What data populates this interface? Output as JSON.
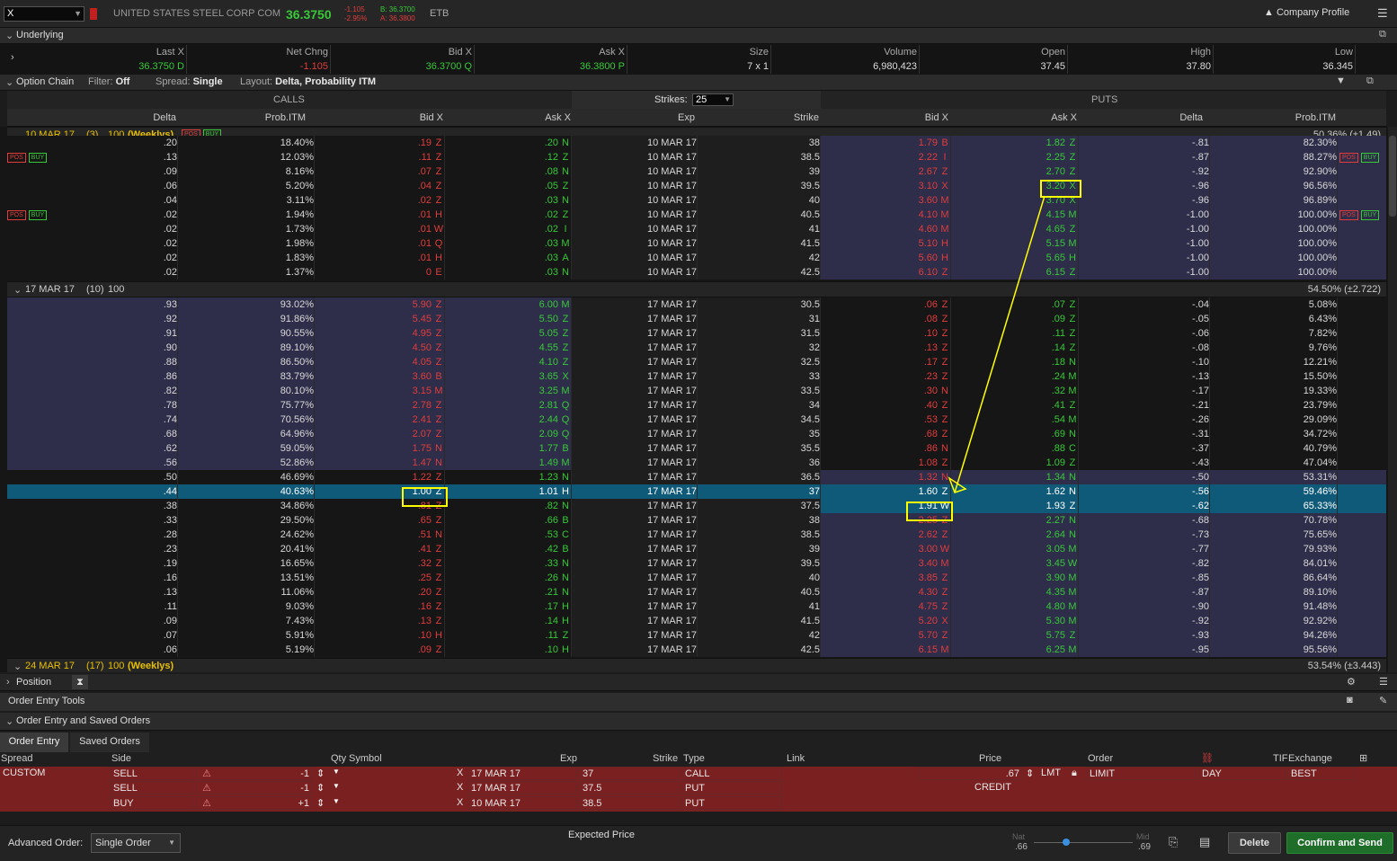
{
  "topbar": {
    "symbol": "X",
    "company": "UNITED STATES STEEL CORP COM",
    "last": "36.3750",
    "chg": "-1.105",
    "chg_pct": "-2.95%",
    "bid": "B: 36.3700",
    "ask": "A: 36.3800",
    "etb": "ETB",
    "profile": "Company Profile"
  },
  "underlying": {
    "title": "Underlying",
    "headers": [
      "Last X",
      "Net Chng",
      "Bid X",
      "Ask X",
      "Size",
      "Volume",
      "Open",
      "High",
      "Low"
    ],
    "values": [
      "36.3750 D",
      "-1.105",
      "36.3700 Q",
      "36.3800 P",
      "7 x 1",
      "6,980,423",
      "37.45",
      "37.80",
      "36.345"
    ]
  },
  "chain_toolbar": {
    "title": "Option Chain",
    "filter_label": "Filter:",
    "filter": "Off",
    "spread_label": "Spread:",
    "spread": "Single",
    "layout_label": "Layout:",
    "layout": "Delta, Probability ITM",
    "calls": "CALLS",
    "puts": "PUTS",
    "strikes_label": "Strikes:",
    "strikes": "25"
  },
  "col_headers": {
    "c_delta": "Delta",
    "c_prob": "Prob.ITM",
    "c_bid": "Bid X",
    "c_ask": "Ask X",
    "exp": "Exp",
    "strike": "Strike",
    "p_bid": "Bid X",
    "p_ask": "Ask X",
    "p_delta": "Delta",
    "p_prob": "Prob.ITM"
  },
  "badges": {
    "pos": "POS",
    "buy": "BUY"
  },
  "group1": {
    "date": "10 MAR 17",
    "count": "(3)",
    "mult": "100",
    "tag": "(Weeklys)",
    "iv": "50.36% (±1.49)"
  },
  "group1_rows": [
    {
      "cd": ".20",
      "cp": "18.40%",
      "cb": ".19",
      "cbx": "Z",
      "ca": ".20",
      "cax": "N",
      "exp": "10 MAR 17",
      "k": "38",
      "pb": "1.79",
      "pbx": "B",
      "pa": "1.82",
      "pax": "Z",
      "pd": "-.81",
      "pp": "82.30%"
    },
    {
      "cd": ".13",
      "cp": "12.03%",
      "cb": ".11",
      "cbx": "Z",
      "ca": ".12",
      "cax": "Z",
      "exp": "10 MAR 17",
      "k": "38.5",
      "pb": "2.22",
      "pbx": "I",
      "pa": "2.25",
      "pax": "Z",
      "pd": "-.87",
      "pp": "88.27%"
    },
    {
      "cd": ".09",
      "cp": "8.16%",
      "cb": ".07",
      "cbx": "Z",
      "ca": ".08",
      "cax": "N",
      "exp": "10 MAR 17",
      "k": "39",
      "pb": "2.67",
      "pbx": "Z",
      "pa": "2.70",
      "pax": "Z",
      "pd": "-.92",
      "pp": "92.90%"
    },
    {
      "cd": ".06",
      "cp": "5.20%",
      "cb": ".04",
      "cbx": "Z",
      "ca": ".05",
      "cax": "Z",
      "exp": "10 MAR 17",
      "k": "39.5",
      "pb": "3.10",
      "pbx": "X",
      "pa": "3.20",
      "pax": "X",
      "pd": "-.96",
      "pp": "96.56%"
    },
    {
      "cd": ".04",
      "cp": "3.11%",
      "cb": ".02",
      "cbx": "Z",
      "ca": ".03",
      "cax": "N",
      "exp": "10 MAR 17",
      "k": "40",
      "pb": "3.60",
      "pbx": "M",
      "pa": "3.70",
      "pax": "X",
      "pd": "-.96",
      "pp": "96.89%"
    },
    {
      "cd": ".02",
      "cp": "1.94%",
      "cb": ".01",
      "cbx": "H",
      "ca": ".02",
      "cax": "Z",
      "exp": "10 MAR 17",
      "k": "40.5",
      "pb": "4.10",
      "pbx": "M",
      "pa": "4.15",
      "pax": "M",
      "pd": "-1.00",
      "pp": "100.00%"
    },
    {
      "cd": ".02",
      "cp": "1.73%",
      "cb": ".01",
      "cbx": "W",
      "ca": ".02",
      "cax": "I",
      "exp": "10 MAR 17",
      "k": "41",
      "pb": "4.60",
      "pbx": "M",
      "pa": "4.65",
      "pax": "Z",
      "pd": "-1.00",
      "pp": "100.00%"
    },
    {
      "cd": ".02",
      "cp": "1.98%",
      "cb": ".01",
      "cbx": "Q",
      "ca": ".03",
      "cax": "M",
      "exp": "10 MAR 17",
      "k": "41.5",
      "pb": "5.10",
      "pbx": "H",
      "pa": "5.15",
      "pax": "M",
      "pd": "-1.00",
      "pp": "100.00%"
    },
    {
      "cd": ".02",
      "cp": "1.83%",
      "cb": ".01",
      "cbx": "H",
      "ca": ".03",
      "cax": "A",
      "exp": "10 MAR 17",
      "k": "42",
      "pb": "5.60",
      "pbx": "H",
      "pa": "5.65",
      "pax": "H",
      "pd": "-1.00",
      "pp": "100.00%"
    },
    {
      "cd": ".02",
      "cp": "1.37%",
      "cb": "0",
      "cbx": "E",
      "ca": ".03",
      "cax": "N",
      "exp": "10 MAR 17",
      "k": "42.5",
      "pb": "6.10",
      "pbx": "Z",
      "pa": "6.15",
      "pax": "Z",
      "pd": "-1.00",
      "pp": "100.00%"
    }
  ],
  "group2": {
    "date": "17 MAR 17",
    "count": "(10)",
    "mult": "100",
    "tag": "",
    "iv": "54.50% (±2.722)"
  },
  "group2_rows": [
    {
      "cd": ".93",
      "cp": "93.02%",
      "cb": "5.90",
      "cbx": "Z",
      "ca": "6.00",
      "cax": "M",
      "exp": "17 MAR 17",
      "k": "30.5",
      "pb": ".06",
      "pbx": "Z",
      "pa": ".07",
      "pax": "Z",
      "pd": "-.04",
      "pp": "5.08%"
    },
    {
      "cd": ".92",
      "cp": "91.86%",
      "cb": "5.45",
      "cbx": "Z",
      "ca": "5.50",
      "cax": "Z",
      "exp": "17 MAR 17",
      "k": "31",
      "pb": ".08",
      "pbx": "Z",
      "pa": ".09",
      "pax": "Z",
      "pd": "-.05",
      "pp": "6.43%"
    },
    {
      "cd": ".91",
      "cp": "90.55%",
      "cb": "4.95",
      "cbx": "Z",
      "ca": "5.05",
      "cax": "Z",
      "exp": "17 MAR 17",
      "k": "31.5",
      "pb": ".10",
      "pbx": "Z",
      "pa": ".11",
      "pax": "Z",
      "pd": "-.06",
      "pp": "7.82%"
    },
    {
      "cd": ".90",
      "cp": "89.10%",
      "cb": "4.50",
      "cbx": "Z",
      "ca": "4.55",
      "cax": "Z",
      "exp": "17 MAR 17",
      "k": "32",
      "pb": ".13",
      "pbx": "Z",
      "pa": ".14",
      "pax": "Z",
      "pd": "-.08",
      "pp": "9.76%"
    },
    {
      "cd": ".88",
      "cp": "86.50%",
      "cb": "4.05",
      "cbx": "Z",
      "ca": "4.10",
      "cax": "Z",
      "exp": "17 MAR 17",
      "k": "32.5",
      "pb": ".17",
      "pbx": "Z",
      "pa": ".18",
      "pax": "N",
      "pd": "-.10",
      "pp": "12.21%"
    },
    {
      "cd": ".86",
      "cp": "83.79%",
      "cb": "3.60",
      "cbx": "B",
      "ca": "3.65",
      "cax": "X",
      "exp": "17 MAR 17",
      "k": "33",
      "pb": ".23",
      "pbx": "Z",
      "pa": ".24",
      "pax": "M",
      "pd": "-.13",
      "pp": "15.50%"
    },
    {
      "cd": ".82",
      "cp": "80.10%",
      "cb": "3.15",
      "cbx": "M",
      "ca": "3.25",
      "cax": "M",
      "exp": "17 MAR 17",
      "k": "33.5",
      "pb": ".30",
      "pbx": "N",
      "pa": ".32",
      "pax": "M",
      "pd": "-.17",
      "pp": "19.33%"
    },
    {
      "cd": ".78",
      "cp": "75.77%",
      "cb": "2.78",
      "cbx": "Z",
      "ca": "2.81",
      "cax": "Q",
      "exp": "17 MAR 17",
      "k": "34",
      "pb": ".40",
      "pbx": "Z",
      "pa": ".41",
      "pax": "Z",
      "pd": "-.21",
      "pp": "23.79%"
    },
    {
      "cd": ".74",
      "cp": "70.56%",
      "cb": "2.41",
      "cbx": "Z",
      "ca": "2.44",
      "cax": "Q",
      "exp": "17 MAR 17",
      "k": "34.5",
      "pb": ".53",
      "pbx": "Z",
      "pa": ".54",
      "pax": "M",
      "pd": "-.26",
      "pp": "29.09%"
    },
    {
      "cd": ".68",
      "cp": "64.96%",
      "cb": "2.07",
      "cbx": "Z",
      "ca": "2.09",
      "cax": "Q",
      "exp": "17 MAR 17",
      "k": "35",
      "pb": ".68",
      "pbx": "Z",
      "pa": ".69",
      "pax": "N",
      "pd": "-.31",
      "pp": "34.72%"
    },
    {
      "cd": ".62",
      "cp": "59.05%",
      "cb": "1.75",
      "cbx": "N",
      "ca": "1.77",
      "cax": "B",
      "exp": "17 MAR 17",
      "k": "35.5",
      "pb": ".86",
      "pbx": "N",
      "pa": ".88",
      "pax": "C",
      "pd": "-.37",
      "pp": "40.79%"
    },
    {
      "cd": ".56",
      "cp": "52.86%",
      "cb": "1.47",
      "cbx": "N",
      "ca": "1.49",
      "cax": "M",
      "exp": "17 MAR 17",
      "k": "36",
      "pb": "1.08",
      "pbx": "Z",
      "pa": "1.09",
      "pax": "Z",
      "pd": "-.43",
      "pp": "47.04%"
    },
    {
      "cd": ".50",
      "cp": "46.69%",
      "cb": "1.22",
      "cbx": "Z",
      "ca": "1.23",
      "cax": "N",
      "exp": "17 MAR 17",
      "k": "36.5",
      "pb": "1.32",
      "pbx": "N",
      "pa": "1.34",
      "pax": "N",
      "pd": "-.50",
      "pp": "53.31%"
    },
    {
      "cd": ".44",
      "cp": "40.63%",
      "cb": "1.00",
      "cbx": "Z",
      "ca": "1.01",
      "cax": "H",
      "exp": "17 MAR 17",
      "k": "37",
      "pb": "1.60",
      "pbx": "Z",
      "pa": "1.62",
      "pax": "N",
      "pd": "-.56",
      "pp": "59.46%"
    },
    {
      "cd": ".38",
      "cp": "34.86%",
      "cb": ".81",
      "cbx": "Z",
      "ca": ".82",
      "cax": "N",
      "exp": "17 MAR 17",
      "k": "37.5",
      "pb": "1.91",
      "pbx": "W",
      "pa": "1.93",
      "pax": "Z",
      "pd": "-.62",
      "pp": "65.33%"
    },
    {
      "cd": ".33",
      "cp": "29.50%",
      "cb": ".65",
      "cbx": "Z",
      "ca": ".66",
      "cax": "B",
      "exp": "17 MAR 17",
      "k": "38",
      "pb": "2.25",
      "pbx": "Z",
      "pa": "2.27",
      "pax": "N",
      "pd": "-.68",
      "pp": "70.78%"
    },
    {
      "cd": ".28",
      "cp": "24.62%",
      "cb": ".51",
      "cbx": "N",
      "ca": ".53",
      "cax": "C",
      "exp": "17 MAR 17",
      "k": "38.5",
      "pb": "2.62",
      "pbx": "Z",
      "pa": "2.64",
      "pax": "N",
      "pd": "-.73",
      "pp": "75.65%"
    },
    {
      "cd": ".23",
      "cp": "20.41%",
      "cb": ".41",
      "cbx": "Z",
      "ca": ".42",
      "cax": "B",
      "exp": "17 MAR 17",
      "k": "39",
      "pb": "3.00",
      "pbx": "W",
      "pa": "3.05",
      "pax": "M",
      "pd": "-.77",
      "pp": "79.93%"
    },
    {
      "cd": ".19",
      "cp": "16.65%",
      "cb": ".32",
      "cbx": "Z",
      "ca": ".33",
      "cax": "N",
      "exp": "17 MAR 17",
      "k": "39.5",
      "pb": "3.40",
      "pbx": "M",
      "pa": "3.45",
      "pax": "W",
      "pd": "-.82",
      "pp": "84.01%"
    },
    {
      "cd": ".16",
      "cp": "13.51%",
      "cb": ".25",
      "cbx": "Z",
      "ca": ".26",
      "cax": "N",
      "exp": "17 MAR 17",
      "k": "40",
      "pb": "3.85",
      "pbx": "Z",
      "pa": "3.90",
      "pax": "M",
      "pd": "-.85",
      "pp": "86.64%"
    },
    {
      "cd": ".13",
      "cp": "11.06%",
      "cb": ".20",
      "cbx": "Z",
      "ca": ".21",
      "cax": "N",
      "exp": "17 MAR 17",
      "k": "40.5",
      "pb": "4.30",
      "pbx": "Z",
      "pa": "4.35",
      "pax": "M",
      "pd": "-.87",
      "pp": "89.10%"
    },
    {
      "cd": ".11",
      "cp": "9.03%",
      "cb": ".16",
      "cbx": "Z",
      "ca": ".17",
      "cax": "H",
      "exp": "17 MAR 17",
      "k": "41",
      "pb": "4.75",
      "pbx": "Z",
      "pa": "4.80",
      "pax": "M",
      "pd": "-.90",
      "pp": "91.48%"
    },
    {
      "cd": ".09",
      "cp": "7.43%",
      "cb": ".13",
      "cbx": "Z",
      "ca": ".14",
      "cax": "H",
      "exp": "17 MAR 17",
      "k": "41.5",
      "pb": "5.20",
      "pbx": "X",
      "pa": "5.30",
      "pax": "M",
      "pd": "-.92",
      "pp": "92.92%"
    },
    {
      "cd": ".07",
      "cp": "5.91%",
      "cb": ".10",
      "cbx": "H",
      "ca": ".11",
      "cax": "Z",
      "exp": "17 MAR 17",
      "k": "42",
      "pb": "5.70",
      "pbx": "Z",
      "pa": "5.75",
      "pax": "Z",
      "pd": "-.93",
      "pp": "94.26%"
    },
    {
      "cd": ".06",
      "cp": "5.19%",
      "cb": ".09",
      "cbx": "Z",
      "ca": ".10",
      "cax": "H",
      "exp": "17 MAR 17",
      "k": "42.5",
      "pb": "6.15",
      "pbx": "M",
      "pa": "6.25",
      "pax": "M",
      "pd": "-.95",
      "pp": "95.56%"
    }
  ],
  "group3": {
    "date": "24 MAR 17",
    "count": "(17)",
    "mult": "100",
    "tag": "(Weeklys)",
    "iv": "53.54% (±3.443)"
  },
  "position": {
    "label": "Position"
  },
  "oet": {
    "title": "Order Entry Tools",
    "sub": "Order Entry and Saved Orders",
    "tab1": "Order Entry",
    "tab2": "Saved Orders"
  },
  "order_headers": {
    "spread": "Spread",
    "side": "Side",
    "qty": "Qty",
    "symbol": "Symbol",
    "exp": "Exp",
    "strike": "Strike",
    "type": "Type",
    "link": "Link",
    "price": "Price",
    "order": "Order",
    "tif": "TIF",
    "exchange": "Exchange"
  },
  "order": {
    "spread": "CUSTOM",
    "price": ".67",
    "lmt": "LMT",
    "credit": "CREDIT",
    "order": "LIMIT",
    "tif": "DAY",
    "exchange": "BEST"
  },
  "legs": [
    {
      "side": "SELL",
      "qty": "-1",
      "sym": "X",
      "exp": "17 MAR 17",
      "strike": "37",
      "type": "CALL"
    },
    {
      "side": "SELL",
      "qty": "-1",
      "sym": "X",
      "exp": "17 MAR 17",
      "strike": "37.5",
      "type": "PUT"
    },
    {
      "side": "BUY",
      "qty": "+1",
      "sym": "X",
      "exp": "10 MAR 17",
      "strike": "38.5",
      "type": "PUT"
    }
  ],
  "footer": {
    "adv_label": "Advanced Order:",
    "adv": "Single Order",
    "expected": "Expected  Price",
    "nat_label": "Nat",
    "nat": ".66",
    "mid_label": "Mid",
    "mid": ".69",
    "slider": 0.5,
    "delete": "Delete",
    "confirm": "Confirm and Send"
  },
  "colors": {
    "itm": "#2e2e4a",
    "otm": "#161616",
    "selected": "#0f5a78",
    "highlight": "#ffff00",
    "green": "#38c838",
    "red": "#e03c3c"
  }
}
